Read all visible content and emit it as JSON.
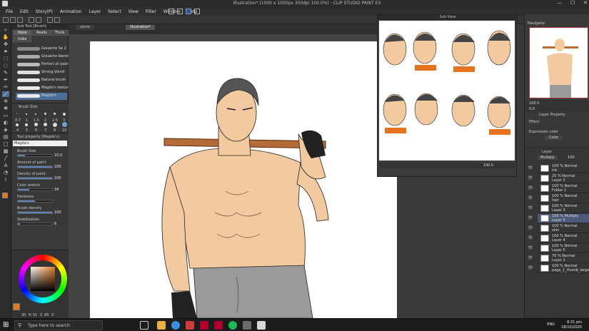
{
  "window": {
    "title": "Illustration* (1000 x 1000px 350dpi 100.0%) - CLIP STUDIO PAINT EX",
    "controls": [
      "—",
      "☐",
      "✕"
    ]
  },
  "menu": [
    "File",
    "Edit",
    "Story(P)",
    "Animation",
    "Layer",
    "Select",
    "View",
    "Filter",
    "Window",
    "Help"
  ],
  "subtool": {
    "header": "Sub Tool [Brush]",
    "tabs": [
      "Wate",
      "Realis",
      "Thick"
    ],
    "secondary_tab": "India",
    "brushes": [
      "Gouache Se 2",
      "Gouache blender 2",
      "Perfect oil paint 2",
      "Strong blend",
      "Natural brush",
      "Magda's textured",
      "Magda's"
    ]
  },
  "brush_size": {
    "title": "Brush Size",
    "sizes": [
      "0.7",
      "1",
      "1.5",
      "2",
      "2.5",
      "3",
      "4",
      "5",
      "6",
      "7",
      "8",
      "10"
    ]
  },
  "tool_property": {
    "title": "Tool property [Magda's]",
    "preset_name": "Magda's",
    "fields": [
      {
        "label": "Brush Size",
        "value": "10.0",
        "fill": 0.2
      },
      {
        "label": "Amount of paint",
        "value": "100",
        "fill": 1.0
      },
      {
        "label": "Density of paint",
        "value": "100",
        "fill": 1.0
      },
      {
        "label": "Color stretch",
        "value": "34",
        "fill": 0.34
      },
      {
        "label": "Hardness",
        "value": "",
        "fill": 0.5
      },
      {
        "label": "Brush density",
        "value": "100",
        "fill": 1.0
      },
      {
        "label": "Stabilization",
        "value": "6",
        "fill": 0.06
      }
    ]
  },
  "color": {
    "main": "#e07a20",
    "sub": "#ffffff",
    "values": [
      "30",
      "H",
      "51",
      "S",
      "85",
      "V"
    ]
  },
  "canvas": {
    "tabs": [
      "ukmo",
      "Illustration*"
    ]
  },
  "subview": {
    "title": "Sub View",
    "zoom": "100.0"
  },
  "navigator": {
    "title": "Navigator",
    "zoom": "100.0",
    "rotation": "0.0"
  },
  "layer_property": {
    "title": "Layer Property",
    "effect_label": "Effect",
    "expression_label": "Expression color",
    "expression_value": "Color"
  },
  "layers_panel": {
    "title": "Layer",
    "blend_mode": "Multiply",
    "opacity": "100",
    "rows": [
      {
        "mode": "100 % Normal",
        "name": "ink"
      },
      {
        "mode": "25 % Normal",
        "name": "Layer 2"
      },
      {
        "mode": "100 % Normal",
        "name": "Folder 1"
      },
      {
        "mode": "100 % Normal",
        "name": "hair"
      },
      {
        "mode": "100 % Normal",
        "name": "Layer 3"
      },
      {
        "mode": "100 % Multiply",
        "name": "Layer 5"
      },
      {
        "mode": "100 % Normal",
        "name": "skin"
      },
      {
        "mode": "100 % Normal",
        "name": "Layer 4"
      },
      {
        "mode": "100 % Normal",
        "name": "Layer 5"
      },
      {
        "mode": "70 % Normal",
        "name": "Layer 1"
      },
      {
        "mode": "100 % Normal",
        "name": "page_1_thumb_large"
      }
    ]
  },
  "taskbar": {
    "search_placeholder": "Type here to search",
    "lang": "ENG",
    "time": "8:31 pm",
    "date": "18/10/2020"
  }
}
